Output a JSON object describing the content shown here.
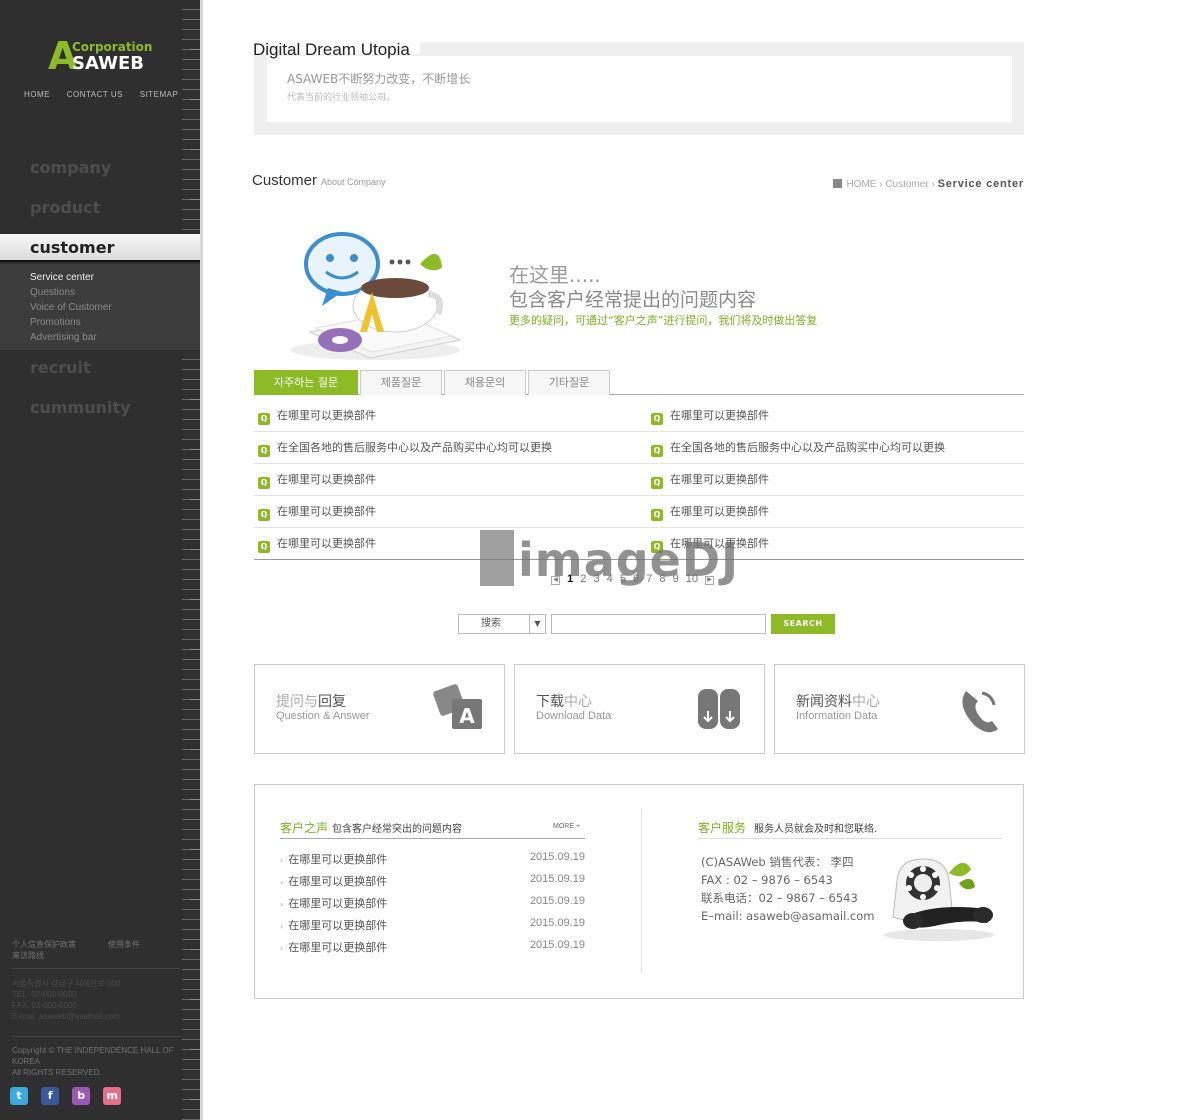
{
  "logo": {
    "letter": "A",
    "corporation": "Corporation",
    "name": "SAWEB"
  },
  "topnav": [
    "HOME",
    "CONTACT US",
    "SITEMAP"
  ],
  "menu": {
    "company": "company",
    "product": "product",
    "customer": "customer",
    "submenu": [
      "Service center",
      "Questions",
      "Voice of Customer",
      "Promotions",
      "Advertising bar"
    ],
    "recruit": "recruit",
    "cummunity": "cummunity"
  },
  "sidefooter": {
    "links1": "个人信息保护政策　　　　使用条件",
    "links2": "来访路线",
    "addr1": "서울특별시 강남구 테헤란로 000",
    "addr2": "TEL. 02-000-0000",
    "addr3": "FAX. 02-000-0000",
    "addr4": "E-mail. asaweb@asamail.com",
    "copy1": "Copyright © THE INDEPENDENCE HALL OF KOREA",
    "copy2": "All RIGHTS RESERVED."
  },
  "social": [
    {
      "icon": "twitter-icon",
      "glyph": "t",
      "color": "#3aa9e0"
    },
    {
      "icon": "facebook-icon",
      "glyph": "f",
      "color": "#3b5998"
    },
    {
      "icon": "blog-icon",
      "glyph": "b",
      "color": "#9b59b6"
    },
    {
      "icon": "me2day-icon",
      "glyph": "m",
      "color": "#e86f8a"
    }
  ],
  "header": {
    "headline": "Digital Dream Utopia",
    "line1": "ASAWEB不断努力改变，不断增长",
    "line2": "代表当前的行业领袖公司。"
  },
  "section": {
    "title": "Customer",
    "subtitle": "About Company"
  },
  "breadcrumb": {
    "home": "HOME",
    "mid": "Customer",
    "current": "Service center"
  },
  "hero": {
    "line1": "在这里.....",
    "line2": "包含客户经常提出的问题内容",
    "line3": "更多的疑问，可通过“客户之声”进行提问，我们将及时做出答复"
  },
  "tabs": [
    "자주하는 질문",
    "제품질문",
    "채용문의",
    "기타질문"
  ],
  "faq": {
    "left": [
      "在哪里可以更换部件",
      "在全国各地的售后服务中心以及产品购买中心均可以更换",
      "在哪里可以更换部件",
      "在哪里可以更换部件",
      "在哪里可以更换部件"
    ],
    "right": [
      "在哪里可以更换部件",
      "在全国各地的售后服务中心以及产品购买中心均可以更换",
      "在哪里可以更换部件",
      "在哪里可以更换部件",
      "在哪里可以更换部件"
    ]
  },
  "pager": {
    "prev": "◀",
    "next": "▶",
    "pages": [
      "1",
      "2",
      "3",
      "4",
      "5",
      "6",
      "7",
      "8",
      "9",
      "10"
    ],
    "current": "1"
  },
  "watermark": "imageDJ",
  "search": {
    "select": "搜索",
    "chevron": "▼",
    "button": "SEARCH"
  },
  "cards": [
    {
      "t_dark": "提问与",
      "t_mid": "回复",
      "sub": "Question & Answer"
    },
    {
      "t_dark": "下载",
      "t_mid": "中心",
      "sub": "Download Data"
    },
    {
      "t_dark": "新闻资料",
      "t_mid": "中心",
      "sub": "Information Data"
    }
  ],
  "voice": {
    "title": "客户之声",
    "desc": "包含客户经常突出的问题内容",
    "more": "MORE +",
    "items": [
      {
        "text": "在哪里可以更换部件",
        "date": "2015.09.19"
      },
      {
        "text": "在哪里可以更换部件",
        "date": "2015.09.19"
      },
      {
        "text": "在哪里可以更换部件",
        "date": "2015.09.19"
      },
      {
        "text": "在哪里可以更换部件",
        "date": "2015.09.19"
      },
      {
        "text": "在哪里可以更换部件",
        "date": "2015.09.19"
      }
    ]
  },
  "service": {
    "title": "客户服务",
    "desc": "服务人员就会及时和您联络.",
    "lines": [
      "(C)ASAWeb 销售代表：  李四",
      "FAX : 02 – 9876 – 6543",
      "联系电话：02 – 9867 – 6543",
      "E–mail: asaweb@asamail.com"
    ]
  },
  "colors": {
    "accent": "#8dbb26",
    "sidebar": "#2f2f2f"
  }
}
